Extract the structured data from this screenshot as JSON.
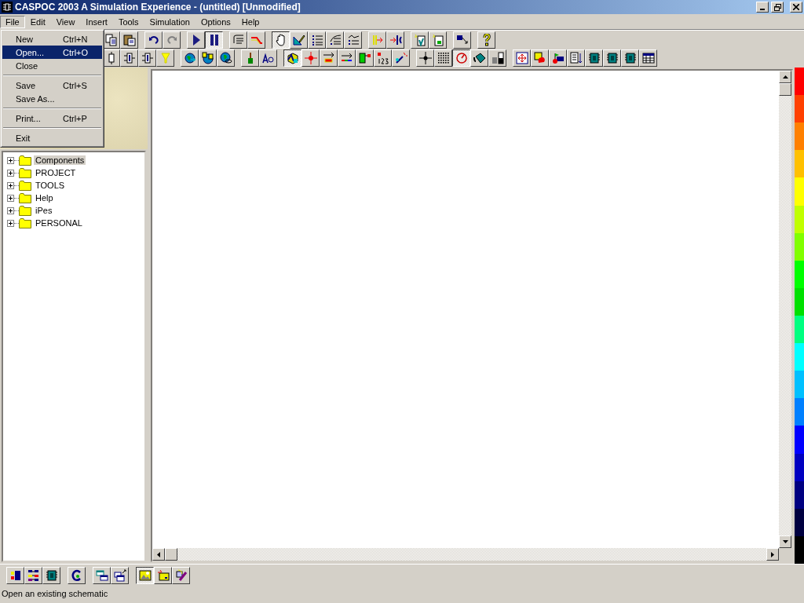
{
  "window": {
    "title": "CASPOC 2003 A Simulation Experience - (untitled) [Unmodified]"
  },
  "menu_bar": [
    {
      "label": "File",
      "selected": true
    },
    {
      "label": "Edit",
      "selected": false
    },
    {
      "label": "View",
      "selected": false
    },
    {
      "label": "Insert",
      "selected": false
    },
    {
      "label": "Tools",
      "selected": false
    },
    {
      "label": "Simulation",
      "selected": false
    },
    {
      "label": "Options",
      "selected": false
    },
    {
      "label": "Help",
      "selected": false
    }
  ],
  "file_menu": [
    {
      "kind": "item",
      "label": "New",
      "shortcut": "Ctrl+N",
      "selected": false
    },
    {
      "kind": "item",
      "label": "Open...",
      "shortcut": "Ctrl+O",
      "selected": true
    },
    {
      "kind": "item",
      "label": "Close",
      "selected": false
    },
    {
      "kind": "separator"
    },
    {
      "kind": "item",
      "label": "Save",
      "shortcut": "Ctrl+S",
      "selected": false
    },
    {
      "kind": "item",
      "label": "Save As...",
      "selected": false
    },
    {
      "kind": "separator"
    },
    {
      "kind": "item",
      "label": "Print...",
      "shortcut": "Ctrl+P",
      "selected": false
    },
    {
      "kind": "separator"
    },
    {
      "kind": "item",
      "label": "Exit",
      "selected": false
    }
  ],
  "toolbar_rows": [
    [
      [
        {
          "pressed": false
        },
        {
          "pressed": false
        }
      ],
      [
        {
          "pressed": false
        },
        {
          "pressed": false
        }
      ],
      [
        {
          "pressed": false
        },
        {
          "pressed": true
        }
      ],
      [
        {
          "pressed": false
        },
        {
          "pressed": false
        }
      ],
      [
        {
          "pressed": true
        },
        {
          "pressed": false
        },
        {
          "pressed": false
        },
        {
          "pressed": false
        },
        {
          "pressed": false
        }
      ],
      [
        {
          "pressed": false
        },
        {
          "pressed": false
        }
      ],
      [
        {
          "pressed": false
        },
        {
          "pressed": false
        }
      ],
      [
        {
          "pressed": false
        }
      ],
      [
        {
          "pressed": false
        }
      ]
    ],
    [
      [
        {
          "pressed": false
        },
        {
          "pressed": false
        },
        {
          "pressed": false
        },
        {
          "pressed": false
        }
      ],
      [
        {
          "pressed": false
        },
        {
          "pressed": false
        },
        {
          "pressed": false
        }
      ],
      [
        {
          "pressed": false
        },
        {
          "pressed": false
        }
      ],
      [
        {
          "pressed": true
        },
        {
          "pressed": false
        },
        {
          "pressed": false
        },
        {
          "pressed": false
        },
        {
          "pressed": false
        },
        {
          "pressed": false
        },
        {
          "pressed": false
        }
      ],
      [
        {
          "pressed": false
        },
        {
          "pressed": false
        },
        {
          "pressed": true
        },
        {
          "pressed": false
        },
        {
          "pressed": false
        }
      ],
      [
        {
          "pressed": false
        },
        {
          "pressed": false
        },
        {
          "pressed": false
        },
        {
          "pressed": false
        },
        {
          "pressed": false
        },
        {
          "pressed": false
        },
        {
          "pressed": false
        },
        {
          "pressed": false
        }
      ]
    ]
  ],
  "tree": [
    {
      "label": "Components",
      "selected": true,
      "expanded": false
    },
    {
      "label": "PROJECT",
      "selected": false,
      "expanded": false
    },
    {
      "label": "TOOLS",
      "selected": false,
      "expanded": false
    },
    {
      "label": "Help",
      "selected": false,
      "expanded": false
    },
    {
      "label": "iPes",
      "selected": false,
      "expanded": false
    },
    {
      "label": "PERSONAL",
      "selected": false,
      "expanded": false
    }
  ],
  "bottom_toolbar": [
    [
      {
        "pressed": false
      },
      {
        "pressed": false
      },
      {
        "pressed": false
      }
    ],
    [
      {
        "pressed": false
      }
    ],
    [
      {
        "pressed": false
      },
      {
        "pressed": false
      }
    ],
    [
      {
        "pressed": true
      },
      {
        "pressed": false
      },
      {
        "pressed": false
      }
    ]
  ],
  "status_bar": {
    "text": "Open an existing schematic"
  }
}
